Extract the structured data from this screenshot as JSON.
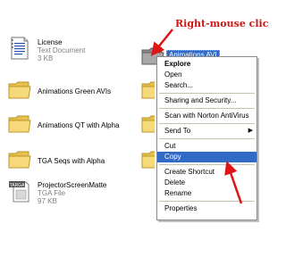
{
  "annotation": "Right-mouse click",
  "files": [
    {
      "name": "License",
      "type": "Text Document",
      "size": "3 KB"
    },
    {
      "name": "Animations Green AVIs"
    },
    {
      "name": "Animations QT with Alpha"
    },
    {
      "name": "TGA Seqs with Alpha"
    },
    {
      "name": "ProjectorScreenMatte",
      "type": "TGA File",
      "size": "97 KB",
      "badge": "TARGA"
    }
  ],
  "selected_file": "Animations AVI",
  "context_menu": {
    "items": [
      {
        "label": "Explore",
        "bold": true
      },
      {
        "label": "Open"
      },
      {
        "label": "Search..."
      },
      {
        "separator": true
      },
      {
        "label": "Sharing and Security..."
      },
      {
        "separator": true
      },
      {
        "label": "Scan with Norton AntiVirus"
      },
      {
        "separator": true
      },
      {
        "label": "Send To",
        "submenu": true
      },
      {
        "separator": true
      },
      {
        "label": "Cut"
      },
      {
        "label": "Copy",
        "highlighted": true
      },
      {
        "separator": true
      },
      {
        "label": "Create Shortcut"
      },
      {
        "label": "Delete"
      },
      {
        "label": "Rename"
      },
      {
        "separator": true
      },
      {
        "label": "Properties"
      }
    ]
  },
  "colors": {
    "annotation": "#d01818",
    "highlight": "#316ac5",
    "folder": "#f3d46a"
  }
}
